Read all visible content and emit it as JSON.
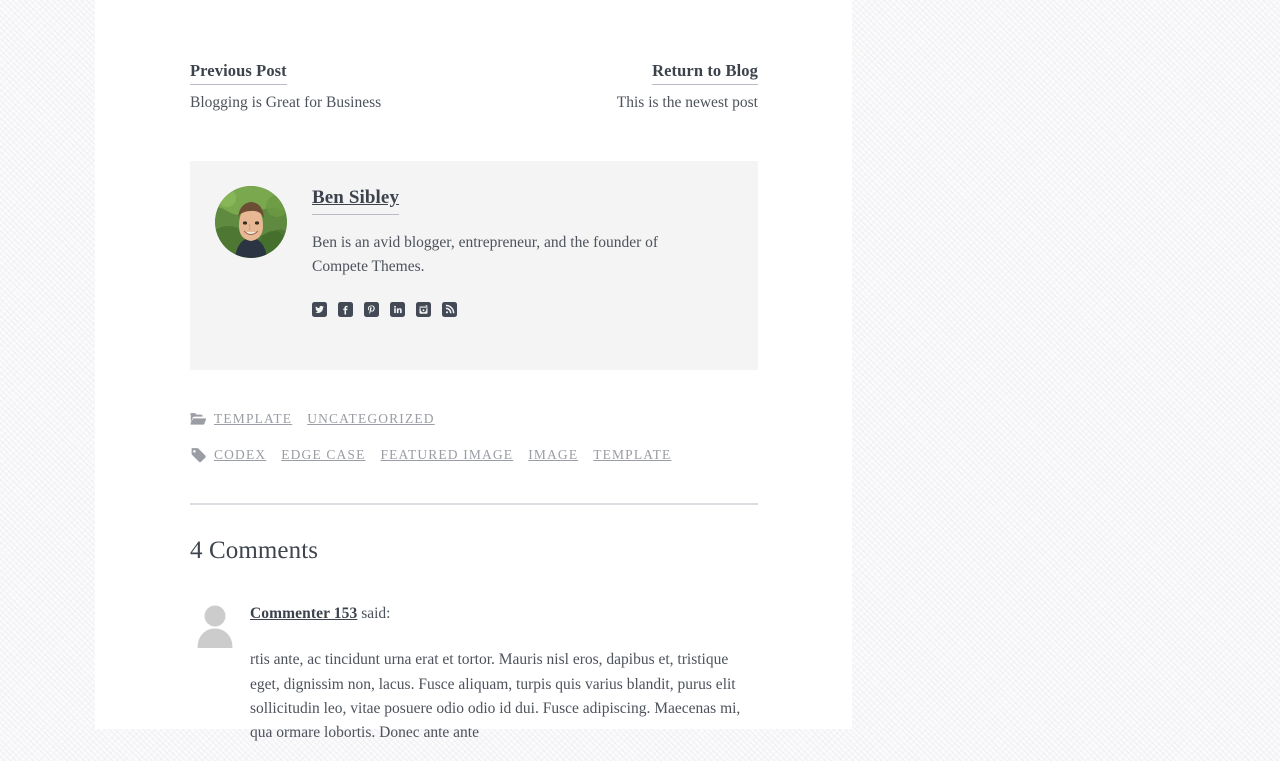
{
  "post_navigation": {
    "previous": {
      "label": "Previous Post",
      "title": "Blogging is Great for Business"
    },
    "next": {
      "label": "Return to Blog",
      "title": "This is the newest post"
    }
  },
  "author_box": {
    "avatar_alt": "Ben Sibley",
    "name": "Ben Sibley",
    "bio": "Ben is an avid blogger, entrepreneur, and the founder of Compete Themes.",
    "social_links": [
      {
        "name": "twitter-icon",
        "label": "Twitter"
      },
      {
        "name": "facebook-icon",
        "label": "Facebook"
      },
      {
        "name": "pinterest-icon",
        "label": "Pinterest"
      },
      {
        "name": "linkedin-icon",
        "label": "LinkedIn"
      },
      {
        "name": "instagram-icon",
        "label": "Instagram"
      },
      {
        "name": "rss-icon",
        "label": "RSS"
      }
    ],
    "background_color": "#f4f4f5",
    "icon_color": "#434a55"
  },
  "entry_meta": {
    "categories": {
      "icon": "folder-open-icon",
      "items": [
        "Template",
        "Uncategorized"
      ]
    },
    "tags": {
      "icon": "tag-icon",
      "items": [
        "Codex",
        "Edge Case",
        "Featured Image",
        "Image",
        "Template"
      ]
    },
    "color": "#9a9da4"
  },
  "comments": {
    "heading": "4 Comments",
    "count": 4,
    "items": [
      {
        "author": "Commenter 153",
        "said_label": "said:",
        "avatar": "default-gravatar",
        "text": "rtis ante, ac tincidunt urna erat et tortor. Mauris nisl eros, dapibus et, tristique eget, dignissim non, lacus. Fusce aliquam, turpis quis varius blandit, purus elit sollicitudin leo, vitae posuere odio odio id dui. Fusce adipiscing. Maecenas mi, qua ormare lobortis. Donec ante ante"
      }
    ]
  },
  "theme": {
    "page_background": "#ffffff",
    "body_background": "#fbfbfc",
    "text_color": "#4d525b",
    "heading_color": "#3d434d",
    "divider_color": "#dcdce2"
  }
}
